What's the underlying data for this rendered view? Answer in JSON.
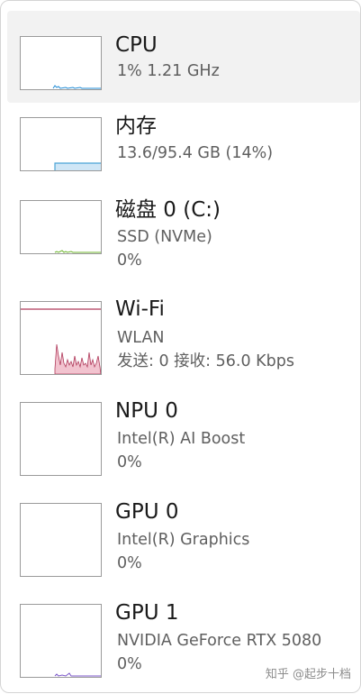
{
  "colors": {
    "cpu": "#1f8bd6",
    "memory": "#4aa3d6",
    "memory_fill": "#cfe6f6",
    "disk": "#6fb62f",
    "wifi": "#b03a5b",
    "wifi_fill": "#f2c3cf",
    "gpu": "#7b57c9"
  },
  "items": [
    {
      "name": "CPU",
      "line1": "1% 1.21 GHz",
      "line2": ""
    },
    {
      "name": "内存",
      "line1": "13.6/95.4 GB (14%)",
      "line2": ""
    },
    {
      "name": "磁盘 0 (C:)",
      "line1": "SSD (NVMe)",
      "line2": "0%"
    },
    {
      "name": "Wi-Fi",
      "line1": "WLAN",
      "line2": "发送: 0 接收: 56.0 Kbps"
    },
    {
      "name": "NPU 0",
      "line1": "Intel(R) AI Boost",
      "line2": "0%"
    },
    {
      "name": "GPU 0",
      "line1": "Intel(R) Graphics",
      "line2": "0%"
    },
    {
      "name": "GPU 1",
      "line1": "NVIDIA GeForce RTX 5080",
      "line2": "0%"
    }
  ],
  "watermark": "知乎 @起步十档"
}
